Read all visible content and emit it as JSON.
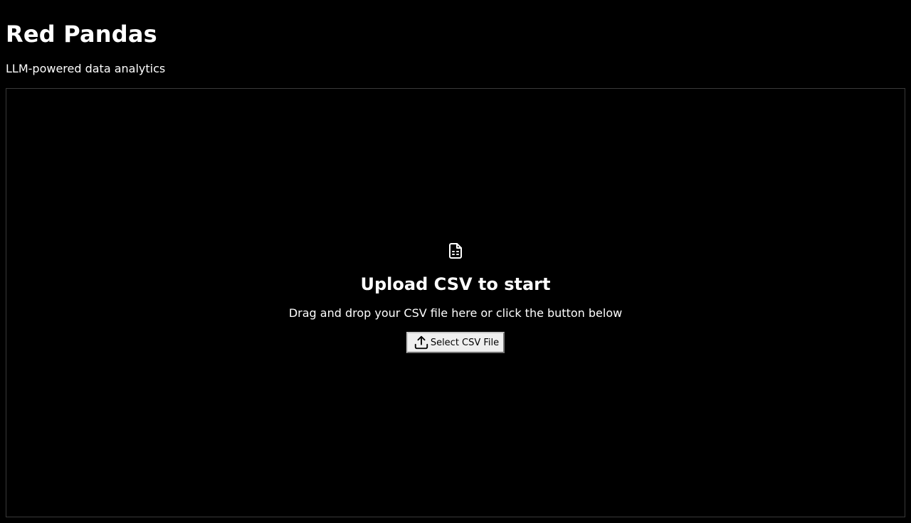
{
  "header": {
    "title": "Red Pandas",
    "subtitle": "LLM-powered data analytics"
  },
  "dropzone": {
    "icon": "file-spreadsheet-icon",
    "title": "Upload CSV to start",
    "description": "Drag and drop your CSV file here or click the button below",
    "button": {
      "icon": "upload-icon",
      "label": "Select CSV File"
    }
  },
  "colors": {
    "background": "#000000",
    "text": "#ffffff",
    "border": "#3a3a3a",
    "button_bg": "#efefef"
  }
}
